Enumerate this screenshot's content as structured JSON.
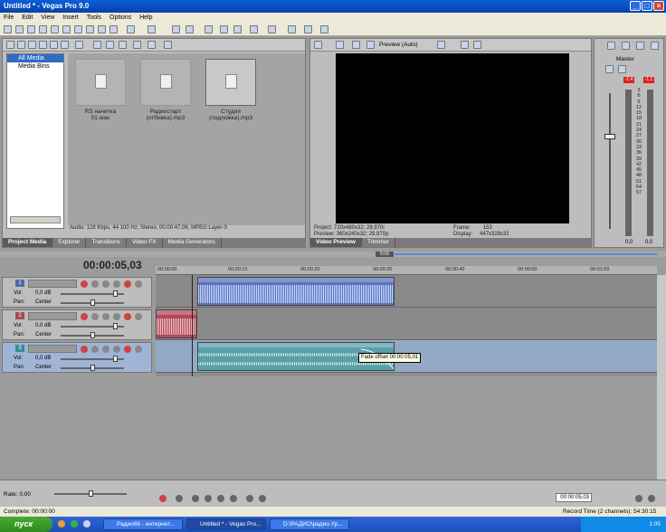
{
  "window": {
    "title": "Untitled * - Vegas Pro 9.0",
    "minimize": "_",
    "maximize": "□",
    "close": "×"
  },
  "menu": [
    "File",
    "Edit",
    "View",
    "Insert",
    "Tools",
    "Options",
    "Help"
  ],
  "media": {
    "tree": [
      {
        "label": "All Media",
        "selected": true
      },
      {
        "label": "Media Bins",
        "selected": false
      }
    ],
    "files": [
      {
        "name": "RS начитка 01.wav",
        "selected": false
      },
      {
        "name": "Радиостарт (отбивка).mp3",
        "selected": false
      },
      {
        "name": "Студия (подложка).mp3",
        "selected": true
      }
    ],
    "info": "Audio: 128 Kbps, 44 100 Hz, Stereo, 00:00:47,06, MPEG Layer-3",
    "tabs": [
      {
        "label": "Project Media",
        "active": true
      },
      {
        "label": "Explorer"
      },
      {
        "label": "Transitions"
      },
      {
        "label": "Video FX"
      },
      {
        "label": "Media Generators"
      }
    ]
  },
  "preview": {
    "mode": "Preview (Auto)",
    "project_label": "Project:",
    "project_value": "720x480x32; 29,970i",
    "preview_label": "Preview:",
    "preview_value": "360x240x32; 29,970p",
    "frame_label": "Frame:",
    "frame_value": "153",
    "display_label": "Display:",
    "display_value": "447x328x32",
    "tabs": [
      {
        "label": "Video Preview",
        "active": true
      },
      {
        "label": "Trimmer"
      }
    ]
  },
  "master": {
    "title": "Master",
    "peak_left": "-1.4",
    "peak_right": "-1.1",
    "scale": [
      "3",
      "6",
      "9",
      "12",
      "15",
      "18",
      "21",
      "24",
      "27",
      "30",
      "33",
      "36",
      "39",
      "42",
      "45",
      "48",
      "51",
      "54",
      "57"
    ],
    "level_left": "0,0",
    "level_right": "0,0"
  },
  "timeline": {
    "timecode": "00:00:05,03",
    "ruler": [
      "00:00:00",
      "00:00:10",
      "00:00:20",
      "00:00:30",
      "00:00:40",
      "00:00:50",
      "00:01:00"
    ],
    "loop_marker": "5:09",
    "tracks": [
      {
        "num": "1",
        "vol_label": "Vol:",
        "vol": "0,0 dB",
        "pan_label": "Pan:",
        "pan": "Center",
        "selected": false
      },
      {
        "num": "2",
        "vol_label": "Vol:",
        "vol": "0,0 dB",
        "pan_label": "Pan:",
        "pan": "Center",
        "selected": false
      },
      {
        "num": "3",
        "vol_label": "Vol:",
        "vol": "0,0 dB",
        "pan_label": "Pan:",
        "pan": "Center",
        "selected": true
      }
    ],
    "tooltip": "Fade offset 00:00:05,01",
    "rate_label": "Rate: 0,00",
    "transport_time": "00:00:05,03"
  },
  "status": {
    "left": "Complete: 00:00:00",
    "right": "Record Time (2 channels): 54:30:15"
  },
  "taskbar": {
    "start": "пуск",
    "tasks": [
      {
        "label": "Радио66 - интернет...",
        "active": false
      },
      {
        "label": "Untitled * - Vegas Pro...",
        "active": true
      },
      {
        "label": "D:\\РАДИО\\радио Ур...",
        "active": false
      }
    ],
    "clock": "1:05"
  },
  "colors": {
    "track1": "#5a74b8",
    "track2": "#b04a5a",
    "track3": "#5aa0a8"
  }
}
